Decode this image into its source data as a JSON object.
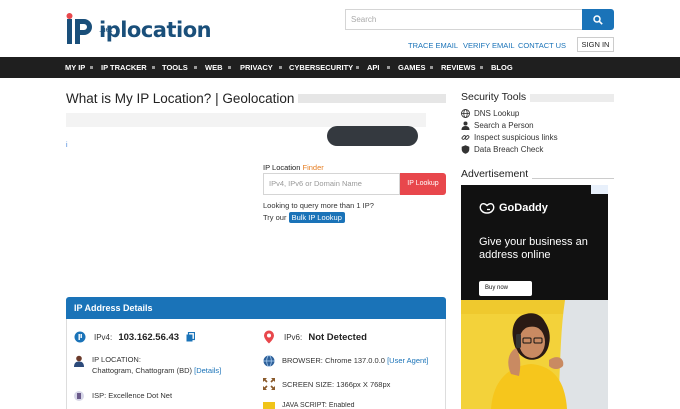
{
  "header": {
    "logo_text": "iplocation",
    "logo_suffix": ".net",
    "search_placeholder": "Search",
    "top_links": [
      "TRACE EMAIL",
      "VERIFY EMAIL",
      "CONTACT US"
    ],
    "signin_label": "SIGN IN"
  },
  "nav": {
    "items": [
      "MY IP",
      "IP TRACKER",
      "TOOLS",
      "WEB",
      "PRIVACY",
      "CYBERSECURITY",
      "API",
      "GAMES",
      "REVIEWS",
      "BLOG"
    ]
  },
  "main": {
    "title": "What is My IP Location? | Geolocation",
    "ad_info": "i",
    "finder": {
      "label": "IP Location",
      "label_highlight": "Finder",
      "placeholder": "IPv4, IPv6 or Domain Name",
      "button": "IP Lookup",
      "looking": "Looking to query more than 1 IP?",
      "try_prefix": "Try our",
      "bulk_link": "Bulk IP Lookup"
    },
    "details": {
      "title": "IP Address Details",
      "ipv4_label": "IPv4:",
      "ipv4_value": "103.162.56.43",
      "ipv6_label": "IPv6:",
      "ipv6_value": "Not Detected",
      "location_label": "IP LOCATION:",
      "location_value": "Chattogram, Chattogram (BD)",
      "location_link": "[Details]",
      "browser_label": "BROWSER:",
      "browser_value": "Chrome 137.0.0.0",
      "browser_link": "[User Agent]",
      "screen_label": "SCREEN SIZE:",
      "screen_value": "1366px X 768px",
      "isp_label": "ISP:",
      "isp_value": "Excellence Dot Net",
      "js_label": "JAVA SCRIPT:",
      "js_value": "Enabled"
    }
  },
  "sidebar": {
    "tools_title": "Security Tools",
    "tools": [
      {
        "label": "DNS Lookup",
        "icon": "globe-icon"
      },
      {
        "label": "Search a Person",
        "icon": "person-icon"
      },
      {
        "label": "Inspect suspicious links",
        "icon": "link-icon"
      },
      {
        "label": "Data Breach Check",
        "icon": "shield-icon"
      }
    ],
    "ad_title": "Advertisement",
    "ad": {
      "brand": "GoDaddy",
      "headline": "Give your business an address online",
      "cta": "Buy now"
    }
  },
  "colors": {
    "brand_blue": "#1a73b8",
    "nav_bg": "#1f1f1f",
    "lookup_red": "#e8474c",
    "finder_orange": "#e67e22"
  }
}
